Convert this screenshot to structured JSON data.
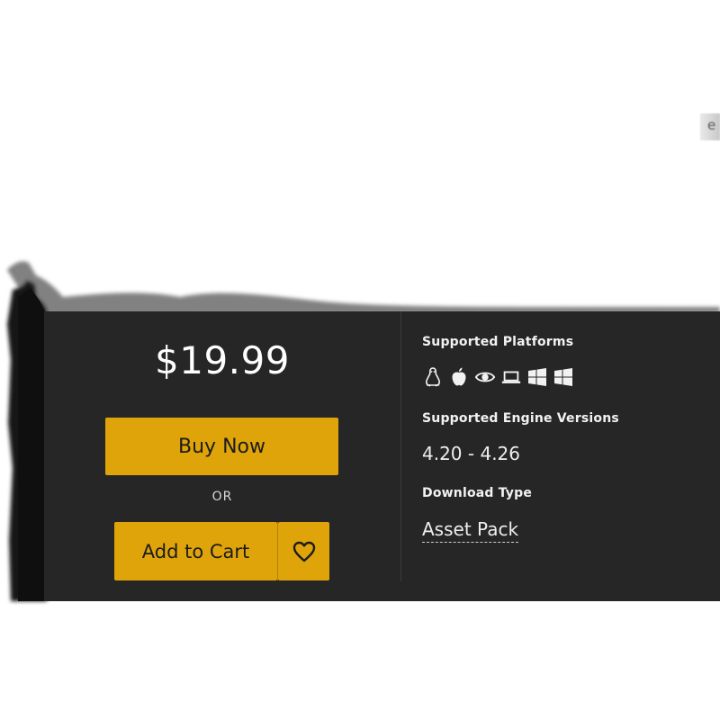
{
  "edge_fragment": {
    "text": "e"
  },
  "purchase": {
    "price": "$19.99",
    "buy_now_label": "Buy Now",
    "or_label": "OR",
    "add_to_cart_label": "Add to Cart",
    "wishlist_icon": "heart-outline-icon"
  },
  "details": {
    "platforms_heading": "Supported Platforms",
    "platform_icons": [
      "linux-icon",
      "apple-icon",
      "eye-icon",
      "laptop-icon",
      "windows-icon",
      "windows-icon"
    ],
    "engine_heading": "Supported Engine Versions",
    "engine_versions": "4.20 - 4.26",
    "download_heading": "Download Type",
    "download_type": "Asset Pack"
  },
  "colors": {
    "panel_bg": "#262626",
    "accent": "#e0a40b",
    "text_light": "#f2f2f2"
  }
}
